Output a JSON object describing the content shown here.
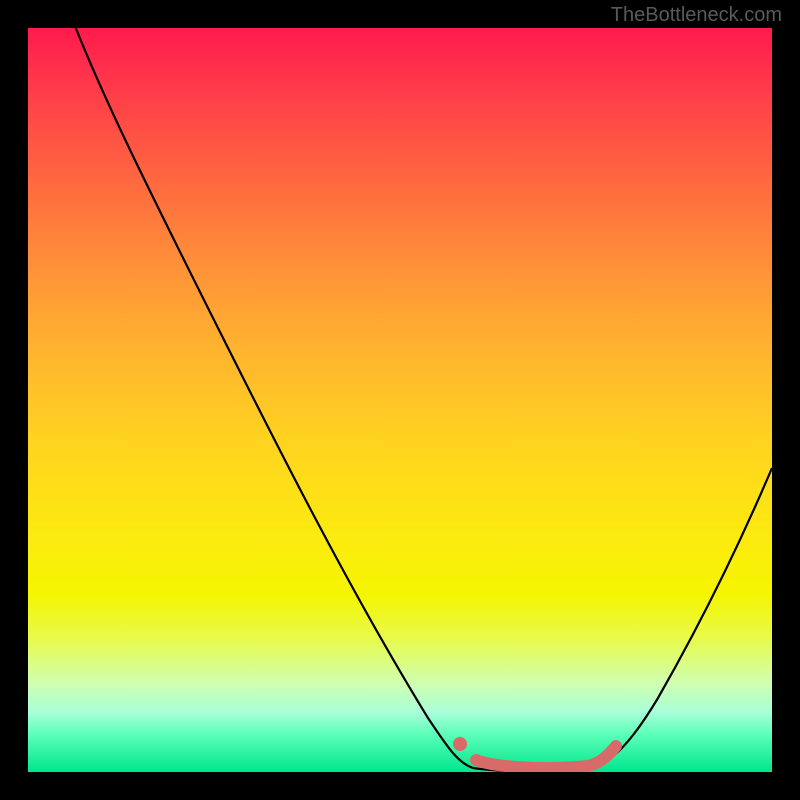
{
  "watermark": "TheBottleneck.com",
  "chart_data": {
    "type": "line",
    "title": "",
    "xlabel": "",
    "ylabel": "",
    "xlim": [
      0,
      100
    ],
    "ylim": [
      0,
      100
    ],
    "x": [
      0,
      3,
      10,
      20,
      30,
      40,
      50,
      55,
      58,
      62,
      68,
      74,
      80,
      86,
      92,
      100
    ],
    "values": [
      110,
      100,
      85,
      68,
      52,
      36,
      20,
      9,
      4,
      1,
      0.5,
      0.5,
      3,
      12,
      26,
      48
    ],
    "background_gradient": {
      "top": "#ff1a4d",
      "mid": "#ffd220",
      "bottom": "#00e68c"
    },
    "marker_region": {
      "x_start": 58,
      "x_end": 78
    },
    "marker_dot": {
      "x": 57,
      "y": 4
    }
  }
}
